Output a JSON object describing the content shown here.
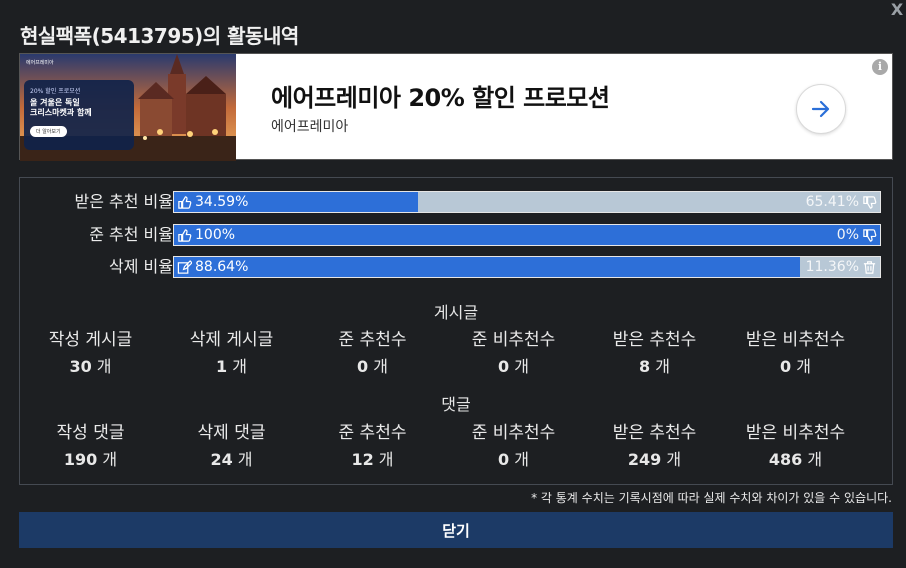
{
  "title": "현실팩폭(5413795)의 활동내역",
  "close_x": "X",
  "ad": {
    "headline": "에어프레미아 20% 할인 프로모션",
    "sub": "에어프레미아",
    "image_tag": "에어프레미아",
    "image_small": "20% 할인 프로모션",
    "image_line1": "올 겨울은 독일",
    "image_line2": "크리스마켓과 함께",
    "image_pill": "더 알아보기",
    "info_glyph": "i"
  },
  "rates": [
    {
      "label": "받은 추천 비율",
      "left_text": "34.59%",
      "right_text": "65.41%",
      "fill": 0.3459,
      "left_icon": "thumbs-up-icon",
      "right_icon": "thumbs-down-icon"
    },
    {
      "label": "준 추천 비율",
      "left_text": "100%",
      "right_text": "0%",
      "fill": 1.0,
      "left_icon": "thumbs-up-icon",
      "right_icon": "thumbs-down-icon"
    },
    {
      "label": "삭제 비율",
      "left_text": "88.64%",
      "right_text": "11.36%",
      "fill": 0.8864,
      "left_icon": "edit-icon",
      "right_icon": "trash-icon"
    }
  ],
  "posts": {
    "title": "게시글",
    "cells": [
      {
        "label": "작성 게시글",
        "value": "30",
        "unit": " 개"
      },
      {
        "label": "삭제 게시글",
        "value": "1",
        "unit": " 개"
      },
      {
        "label": "준 추천수",
        "value": "0",
        "unit": " 개"
      },
      {
        "label": "준 비추천수",
        "value": "0",
        "unit": " 개"
      },
      {
        "label": "받은 추천수",
        "value": "8",
        "unit": " 개"
      },
      {
        "label": "받은 비추천수",
        "value": "0",
        "unit": " 개"
      }
    ]
  },
  "comments": {
    "title": "댓글",
    "cells": [
      {
        "label": "작성 댓글",
        "value": "190",
        "unit": " 개"
      },
      {
        "label": "삭제 댓글",
        "value": "24",
        "unit": " 개"
      },
      {
        "label": "준 추천수",
        "value": "12",
        "unit": " 개"
      },
      {
        "label": "준 비추천수",
        "value": "0",
        "unit": " 개"
      },
      {
        "label": "받은 추천수",
        "value": "249",
        "unit": " 개"
      },
      {
        "label": "받은 비추천수",
        "value": "486",
        "unit": " 개"
      }
    ]
  },
  "footnote": "* 각 통계 수치는 기록시점에 따라 실제 수치와 차이가 있을 수 있습니다.",
  "close_button": "닫기",
  "colors": {
    "bar_fill": "#2d6fd8",
    "bar_track": "#b8c8d6",
    "close_button_bg": "#1c3a66",
    "background": "#1d1f22"
  }
}
